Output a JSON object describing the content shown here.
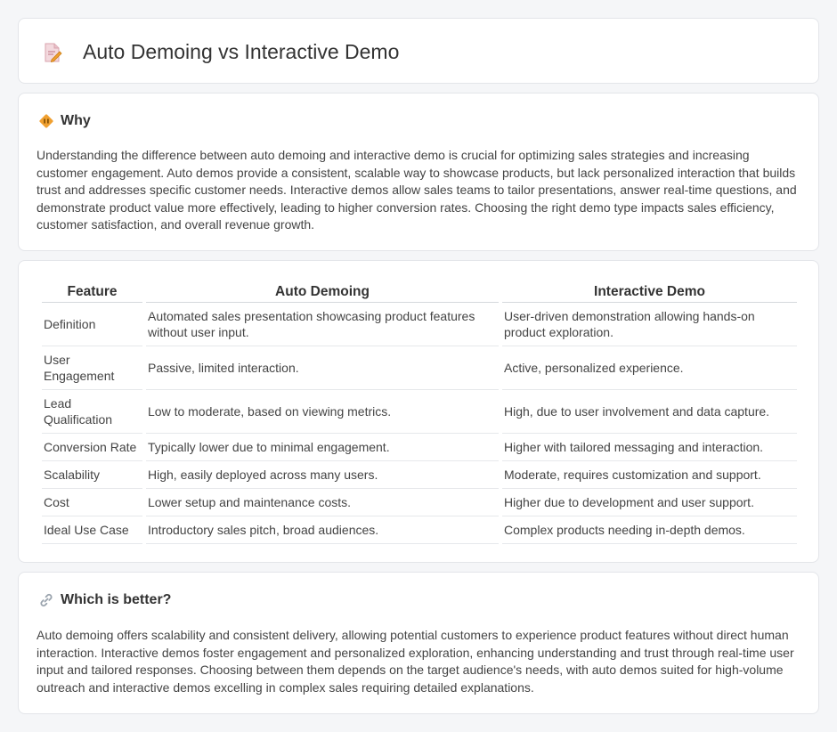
{
  "page": {
    "title": "Auto Demoing vs Interactive Demo",
    "title_icon": "document-pen-icon"
  },
  "why": {
    "icon": "diamond-warning-icon",
    "heading": "Why",
    "body": "Understanding the difference between auto demoing and interactive demo is crucial for optimizing sales strategies and increasing customer engagement. Auto demos provide a consistent, scalable way to showcase products, but lack personalized interaction that builds trust and addresses specific customer needs. Interactive demos allow sales teams to tailor presentations, answer real-time questions, and demonstrate product value more effectively, leading to higher conversion rates. Choosing the right demo type impacts sales efficiency, customer satisfaction, and overall revenue growth."
  },
  "comparison": {
    "headers": [
      "Feature",
      "Auto Demoing",
      "Interactive Demo"
    ],
    "rows": [
      [
        "Definition",
        "Automated sales presentation showcasing product features without user input.",
        "User-driven demonstration allowing hands-on product exploration."
      ],
      [
        "User Engagement",
        "Passive, limited interaction.",
        "Active, personalized experience."
      ],
      [
        "Lead Qualification",
        "Low to moderate, based on viewing metrics.",
        "High, due to user involvement and data capture."
      ],
      [
        "Conversion Rate",
        "Typically lower due to minimal engagement.",
        "Higher with tailored messaging and interaction."
      ],
      [
        "Scalability",
        "High, easily deployed across many users.",
        "Moderate, requires customization and support."
      ],
      [
        "Cost",
        "Lower setup and maintenance costs.",
        "Higher due to development and user support."
      ],
      [
        "Ideal Use Case",
        "Introductory sales pitch, broad audiences.",
        "Complex products needing in-depth demos."
      ]
    ]
  },
  "better": {
    "icon": "link-icon",
    "heading": "Which is better?",
    "body": "Auto demoing offers scalability and consistent delivery, allowing potential customers to experience product features without direct human interaction. Interactive demos foster engagement and personalized exploration, enhancing understanding and trust through real-time user input and tailored responses. Choosing between them depends on the target audience's needs, with auto demos suited for high-volume outreach and interactive demos excelling in complex sales requiring detailed explanations."
  },
  "colors": {
    "background": "#f5f6f8",
    "card": "#ffffff",
    "accent_orange": "#f0a030",
    "icon_pink": "#e9788f"
  }
}
